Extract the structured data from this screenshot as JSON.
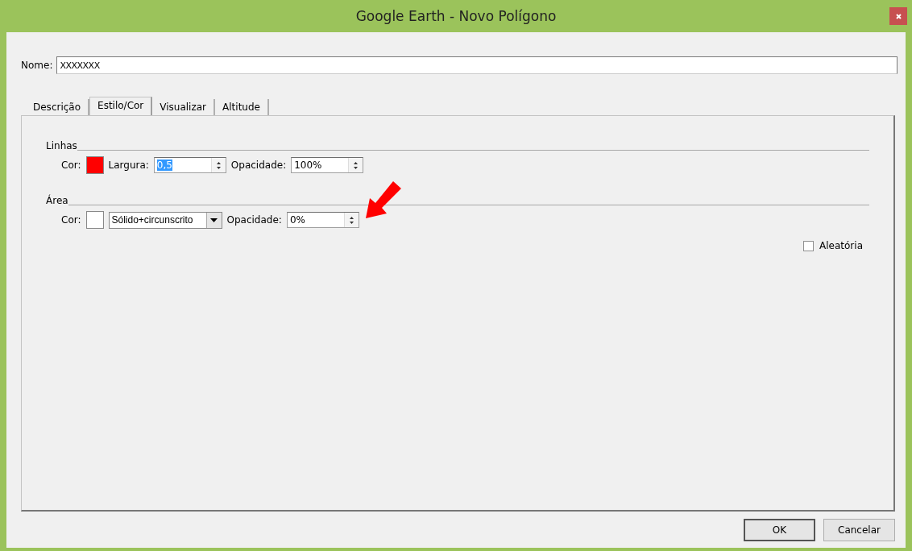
{
  "window": {
    "title": "Google Earth - Novo Polígono"
  },
  "name_field": {
    "label": "Nome:",
    "value": "XXXXXXX"
  },
  "tabs": [
    {
      "label": "Descrição",
      "selected": false
    },
    {
      "label": "Estilo/Cor",
      "selected": true
    },
    {
      "label": "Visualizar",
      "selected": false
    },
    {
      "label": "Altitude",
      "selected": false
    }
  ],
  "sections": [
    {
      "title": "Linhas",
      "controls": [
        {
          "kind": "color",
          "label": "Cor:",
          "color": "#ff0000"
        },
        {
          "kind": "spin",
          "label": "Largura:",
          "value": "0,5",
          "highlighted": true
        },
        {
          "kind": "spin",
          "label": "Opacidade:",
          "value": "100%",
          "highlighted": false
        }
      ]
    },
    {
      "title": "Área",
      "controls": [
        {
          "kind": "color",
          "label": "Cor:",
          "color": "#ffffff"
        },
        {
          "kind": "dropdown",
          "value": "Sólido+circunscrito"
        },
        {
          "kind": "spin",
          "label": "Opacidade:",
          "value": "0%",
          "highlighted": false
        }
      ]
    }
  ],
  "random_checkbox": {
    "label": "Aleatória",
    "checked": false
  },
  "buttons": [
    {
      "label": "OK",
      "default": true
    },
    {
      "label": "Cancelar",
      "default": false
    }
  ]
}
